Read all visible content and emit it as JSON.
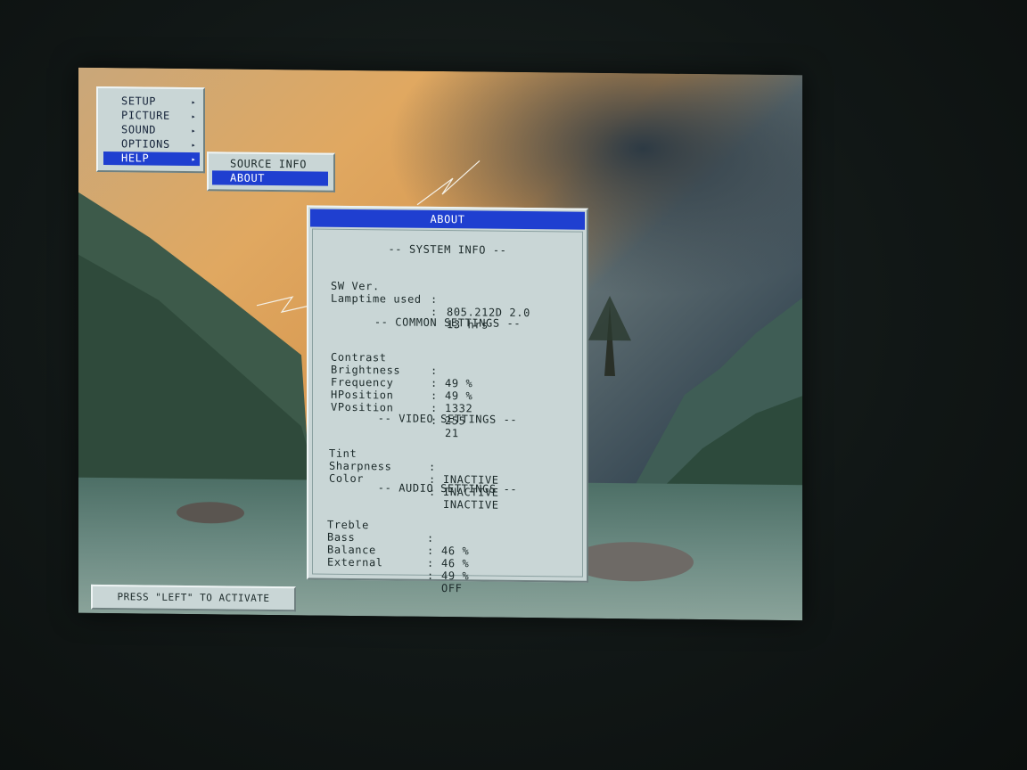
{
  "main_menu": {
    "items": [
      {
        "label": "SETUP",
        "arrow": "▸"
      },
      {
        "label": "PICTURE",
        "arrow": "▸"
      },
      {
        "label": "SOUND",
        "arrow": "▸"
      },
      {
        "label": "OPTIONS",
        "arrow": "▸"
      },
      {
        "label": "HELP",
        "arrow": "▸"
      }
    ],
    "selected": "HELP"
  },
  "help_menu": {
    "items": [
      {
        "label": "SOURCE INFO"
      },
      {
        "label": "ABOUT"
      }
    ],
    "selected": "ABOUT"
  },
  "about": {
    "title": "ABOUT",
    "system_info": {
      "heading": "-- SYSTEM INFO --",
      "rows": [
        {
          "label": "SW Ver.",
          "sep": ":",
          "value": "805.212D 2.0"
        },
        {
          "label": "Lamptime used",
          "sep": ":",
          "value": "13 hrs"
        }
      ]
    },
    "common_settings": {
      "heading": "-- COMMON SETTINGS --",
      "rows": [
        {
          "label": "Contrast",
          "sep": ":",
          "value": "49 %"
        },
        {
          "label": "Brightness",
          "sep": ":",
          "value": "49 %"
        },
        {
          "label": "Frequency",
          "sep": ":",
          "value": "1332"
        },
        {
          "label": "HPosition",
          "sep": ":",
          "value": "255"
        },
        {
          "label": "VPosition",
          "sep": ":",
          "value": "21"
        }
      ]
    },
    "video_settings": {
      "heading": "-- VIDEO SETTINGS --",
      "rows": [
        {
          "label": "Tint",
          "sep": ":",
          "value": "INACTIVE"
        },
        {
          "label": "Sharpness",
          "sep": ":",
          "value": "INACTIVE"
        },
        {
          "label": "Color",
          "sep": ":",
          "value": "INACTIVE"
        }
      ]
    },
    "audio_settings": {
      "heading": "-- AUDIO SETTINGS --",
      "rows": [
        {
          "label": "Treble",
          "sep": ":",
          "value": "46 %"
        },
        {
          "label": "Bass",
          "sep": ":",
          "value": "46 %"
        },
        {
          "label": "Balance",
          "sep": ":",
          "value": "49 %"
        },
        {
          "label": "External",
          "sep": ":",
          "value": "OFF"
        }
      ]
    }
  },
  "hint": {
    "text": "PRESS \"LEFT\" TO ACTIVATE"
  },
  "colors": {
    "highlight": "#1f3fd0",
    "panel": "#c9d6d6"
  }
}
